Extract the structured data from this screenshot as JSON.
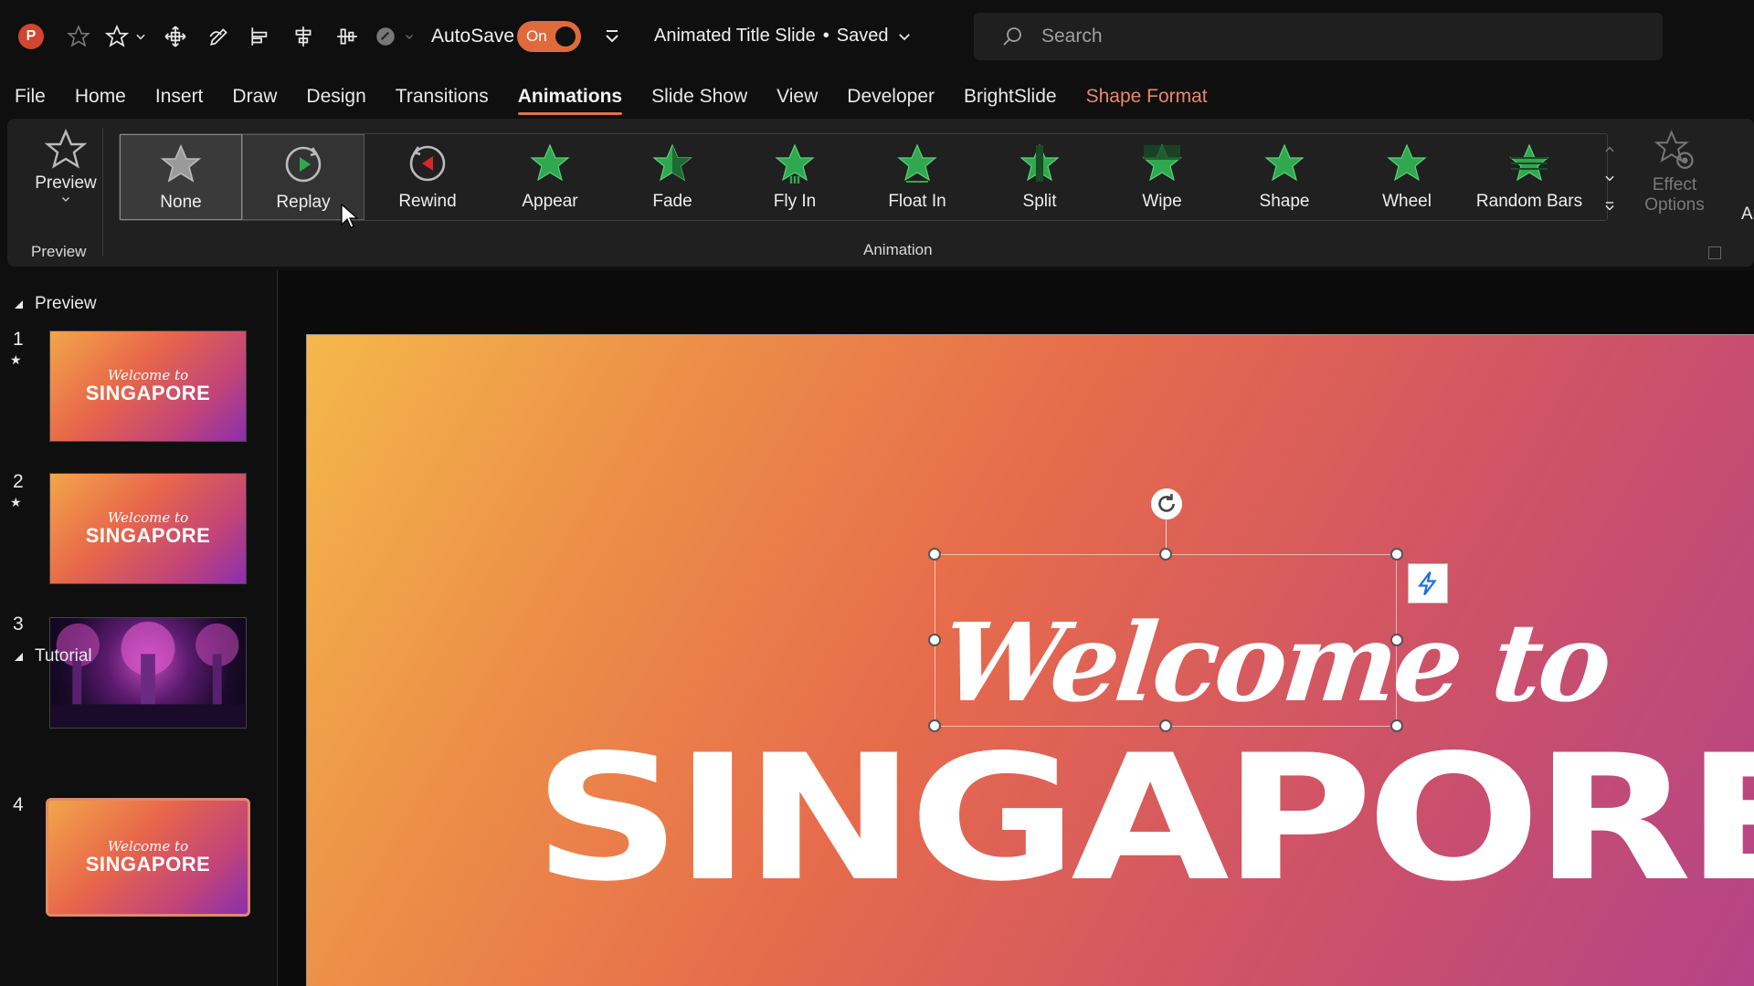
{
  "app": {
    "logo_letter": "P"
  },
  "titlebar": {
    "autosave_label": "AutoSave",
    "autosave_state": "On",
    "doc_title": "Animated Title Slide",
    "doc_status": "Saved",
    "title_separator": "•",
    "search_placeholder": "Search"
  },
  "menu": {
    "tabs": [
      "File",
      "Home",
      "Insert",
      "Draw",
      "Design",
      "Transitions",
      "Animations",
      "Slide Show",
      "View",
      "Developer",
      "BrightSlide",
      "Shape Format"
    ],
    "active": "Animations",
    "contextual": "Shape Format"
  },
  "ribbon": {
    "preview_button": "Preview",
    "preview_group": "Preview",
    "animation_group": "Animation",
    "animations": [
      {
        "label": "None",
        "icon": "star-outline-icon",
        "state": "selected"
      },
      {
        "label": "Replay",
        "icon": "replay-icon",
        "state": "hover"
      },
      {
        "label": "Rewind",
        "icon": "rewind-icon",
        "state": ""
      },
      {
        "label": "Appear",
        "icon": "appear-star-icon",
        "state": ""
      },
      {
        "label": "Fade",
        "icon": "fade-star-icon",
        "state": ""
      },
      {
        "label": "Fly In",
        "icon": "fly-in-star-icon",
        "state": ""
      },
      {
        "label": "Float In",
        "icon": "float-in-star-icon",
        "state": ""
      },
      {
        "label": "Split",
        "icon": "split-star-icon",
        "state": ""
      },
      {
        "label": "Wipe",
        "icon": "wipe-star-icon",
        "state": ""
      },
      {
        "label": "Shape",
        "icon": "shape-star-icon",
        "state": ""
      },
      {
        "label": "Wheel",
        "icon": "wheel-star-icon",
        "state": ""
      },
      {
        "label": "Random Bars",
        "icon": "random-bars-star-icon",
        "state": ""
      }
    ],
    "effect_options_line1": "Effect",
    "effect_options_line2": "Options",
    "truncated_next": "Ar"
  },
  "slides_panel": {
    "sections": [
      {
        "name": "Preview"
      },
      {
        "name": "Tutorial"
      }
    ],
    "slides": [
      {
        "number": "1",
        "has_animation": true,
        "script": "Welcome to",
        "title": "SINGAPORE",
        "kind": "title"
      },
      {
        "number": "2",
        "has_animation": true,
        "script": "Welcome to",
        "title": "SINGAPORE",
        "kind": "title"
      },
      {
        "number": "3",
        "has_animation": false,
        "script": "",
        "title": "",
        "kind": "photo"
      },
      {
        "number": "4",
        "has_animation": false,
        "script": "Welcome to",
        "title": "SINGAPORE",
        "kind": "title",
        "selected": true
      }
    ],
    "star_glyph": "★"
  },
  "slide": {
    "script_text": "Welcome to",
    "title_text": "SINGAPORE"
  },
  "colors": {
    "accent": "#e0734a",
    "star_green": "#2fa84f",
    "rewind_red": "#d9262c",
    "toggle_on": "#e06a3c"
  }
}
